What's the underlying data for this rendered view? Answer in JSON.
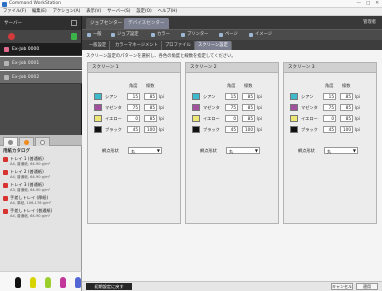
{
  "window": {
    "title": "Command WorkStation",
    "controls": [
      "—",
      "□",
      "✕"
    ]
  },
  "menu": [
    "ファイル(F)",
    "編集(E)",
    "アクション(A)",
    "表示(V)",
    "サーバー(S)",
    "設定(O)",
    "ヘルプ(H)"
  ],
  "left": {
    "header": "サーバー",
    "jobs": [
      {
        "name": "Ex-Job 0000"
      },
      {
        "name": "Ex-Job 0001"
      },
      {
        "name": "Ex-Job 0002"
      }
    ],
    "catalog_title": "用紙カタログ",
    "trays": [
      {
        "name": "トレイ 1 (普通紙)",
        "desc": "A4, 普通紙, 64-90 g/m²"
      },
      {
        "name": "トレイ 2 (普通紙)",
        "desc": "A4, 普通紙, 64-90 g/m²"
      },
      {
        "name": "トレイ 3 (普通紙)",
        "desc": "A3, 普通紙, 64-90 g/m²"
      },
      {
        "name": "手差しトレイ (厚紙)",
        "desc": "A4, 厚紙, 106-176 g/m²"
      },
      {
        "name": "手差しトレイ (普通紙)",
        "desc": "A4, 普通紙, 64-90 g/m²"
      }
    ]
  },
  "consumables": [
    {
      "color": "#111111"
    },
    {
      "color": "#d9d400"
    },
    {
      "color": "#9ccf2c"
    },
    {
      "color": "#c3379b"
    },
    {
      "color": "#5266d6"
    }
  ],
  "tabs": {
    "row1": [
      "ジョブセンター",
      "デバイスセンター"
    ],
    "user": "管理者",
    "row2": [
      "一般",
      "ジョブ設定",
      "カラー",
      "プリンター",
      "ページ",
      "イメージ"
    ],
    "row3": [
      "一般設定",
      "カラーマネージメント",
      "プロファイル",
      "スクリーン設定"
    ]
  },
  "instruction": "スクリーン設定のパターンを選択し、各色の角度と線数を指定してください。",
  "screen_headers": {
    "angle": "角度",
    "lines": "線数",
    "shape_label": "網点形状"
  },
  "screens": [
    {
      "title": "スクリーン 1",
      "shape": "丸",
      "rows": [
        {
          "ink": "シアン",
          "swatch": "#3fb9cc",
          "angle": "15",
          "lines": "85",
          "unit": "lpi"
        },
        {
          "ink": "マゼンタ",
          "swatch": "#a2509e",
          "angle": "75",
          "lines": "85",
          "unit": "lpi"
        },
        {
          "ink": "イエロー",
          "swatch": "#ece676",
          "angle": "0",
          "lines": "85",
          "unit": "lpi"
        },
        {
          "ink": "ブラック",
          "swatch": "#111111",
          "angle": "45",
          "lines": "100",
          "unit": "lpi"
        }
      ]
    },
    {
      "title": "スクリーン 2",
      "shape": "丸",
      "rows": [
        {
          "ink": "シアン",
          "swatch": "#3fb9cc",
          "angle": "15",
          "lines": "85",
          "unit": "lpi"
        },
        {
          "ink": "マゼンタ",
          "swatch": "#a2509e",
          "angle": "75",
          "lines": "85",
          "unit": "lpi"
        },
        {
          "ink": "イエロー",
          "swatch": "#ece676",
          "angle": "0",
          "lines": "85",
          "unit": "lpi"
        },
        {
          "ink": "ブラック",
          "swatch": "#111111",
          "angle": "45",
          "lines": "100",
          "unit": "lpi"
        }
      ]
    },
    {
      "title": "スクリーン 3",
      "shape": "丸",
      "rows": [
        {
          "ink": "シアン",
          "swatch": "#3fb9cc",
          "angle": "15",
          "lines": "85",
          "unit": "lpi"
        },
        {
          "ink": "マゼンタ",
          "swatch": "#a2509e",
          "angle": "75",
          "lines": "85",
          "unit": "lpi"
        },
        {
          "ink": "イエロー",
          "swatch": "#ece676",
          "angle": "0",
          "lines": "85",
          "unit": "lpi"
        },
        {
          "ink": "ブラック",
          "swatch": "#111111",
          "angle": "45",
          "lines": "100",
          "unit": "lpi"
        }
      ]
    }
  ],
  "footer": {
    "reset": "初期設定に戻す",
    "cancel": "キャンセル",
    "apply": "適用"
  }
}
